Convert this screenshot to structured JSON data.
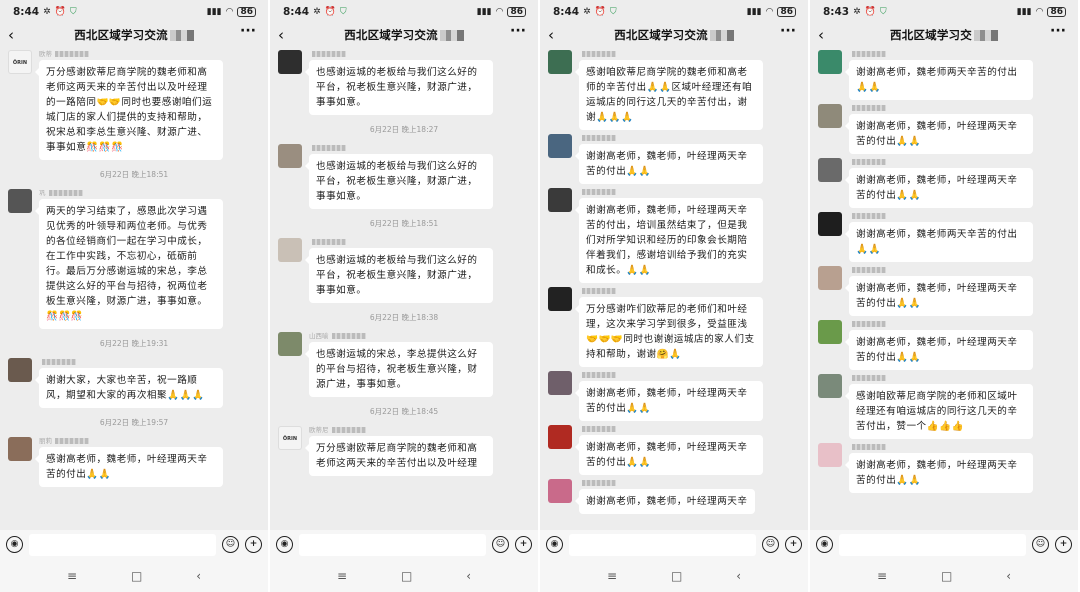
{
  "screens": [
    {
      "status": {
        "time": "8:44",
        "battery": "86"
      },
      "title": "西北区域学习交流",
      "messages": [
        {
          "type": "msg",
          "avatar": "#f4f4f4",
          "avatar_text": "ÖRIN",
          "name": "欧蒂",
          "text": "万分感谢欧蒂尼商学院的魏老师和高老师这两天来的辛苦付出以及叶经理的一路陪同🤝🤝同时也要感谢咱们运城门店的家人们提供的支持和帮助，祝宋总和李总生意兴隆、财源广进、事事如意🎊🎊🎊"
        },
        {
          "type": "time",
          "text": "6月22日 晚上18:51"
        },
        {
          "type": "msg",
          "avatar": "#555",
          "name": "巩",
          "text": "两天的学习结束了，感恩此次学习遇见优秀的叶领导和两位老师。与优秀的各位经销商们一起在学习中成长，在工作中实践，不忘初心，砥砺前行。最后万分感谢运城的宋总，李总提供这么好的平台与招待，祝两位老板生意兴隆，财源广进，事事如意。🎊🎊🎊"
        },
        {
          "type": "time",
          "text": "6月22日 晚上19:31"
        },
        {
          "type": "msg",
          "avatar": "#6a5a4e",
          "name": "",
          "text": "谢谢大家，大家也辛苦，祝一路顺风，期望和大家的再次相聚🙏🙏🙏"
        },
        {
          "type": "time",
          "text": "6月22日 晚上19:57"
        },
        {
          "type": "msg",
          "avatar": "#8a6d5a",
          "name": "丽莉",
          "text": "感谢高老师，魏老师，叶经理两天辛苦的付出🙏🙏"
        }
      ]
    },
    {
      "status": {
        "time": "8:44",
        "battery": "86"
      },
      "title": "西北区域学习交流",
      "messages": [
        {
          "type": "msg",
          "avatar": "#2e2e2e",
          "name": "",
          "text": "也感谢运城的老板给与我们这么好的平台，祝老板生意兴隆，财源广进，事事如意。"
        },
        {
          "type": "time",
          "text": "6月22日 晚上18:27"
        },
        {
          "type": "msg",
          "avatar": "#9a8e80",
          "name": "",
          "text": "也感谢运城的老板给与我们这么好的平台，祝老板生意兴隆，财源广进，事事如意。"
        },
        {
          "type": "time",
          "text": "6月22日 晚上18:51"
        },
        {
          "type": "msg",
          "avatar": "#c9c0b6",
          "name": "",
          "text": "也感谢运城的老板给与我们这么好的平台，祝老板生意兴隆，财源广进，事事如意。"
        },
        {
          "type": "time",
          "text": "6月22日 晚上18:38"
        },
        {
          "type": "msg",
          "avatar": "#7d8a6a",
          "name": "山西喻",
          "text": "也感谢运城的宋总，李总提供这么好的平台与招待，祝老板生意兴隆，财源广进，事事如意。"
        },
        {
          "type": "time",
          "text": "6月22日 晚上18:45"
        },
        {
          "type": "msg",
          "avatar": "#f4f4f4",
          "avatar_text": "ÖRIN",
          "name": "欧蒂尼",
          "text": "万分感谢欧蒂尼商学院的魏老师和高老师这两天来的辛苦付出以及叶经理"
        }
      ]
    },
    {
      "status": {
        "time": "8:44",
        "battery": "86"
      },
      "title": "西北区域学习交流",
      "messages": [
        {
          "type": "msg",
          "avatar": "#3d6e52",
          "name": "",
          "text": "感谢咱欧蒂尼商学院的魏老师和高老师的辛苦付出🙏🙏区域叶经理还有咱运城店的同行这几天的辛苦付出，谢谢🙏🙏🙏"
        },
        {
          "type": "msg",
          "avatar": "#4a6680",
          "name": "",
          "text": "谢谢高老师，魏老师，叶经理两天辛苦的付出🙏🙏"
        },
        {
          "type": "msg",
          "avatar": "#3a3a3a",
          "name": "",
          "text": "谢谢高老师，魏老师，叶经理两天辛苦的付出，培训虽然结束了，但是我们对所学知识和经历的印象会长期陪伴着我们，感谢培训给予我们的充实和成长。🙏🙏"
        },
        {
          "type": "msg",
          "avatar": "#222",
          "name": "",
          "text": "万分感谢咋们欧蒂尼的老师们和叶经理，这次来学习学到很多，受益匪浅🤝🤝🤝同时也谢谢运城店的家人们支持和帮助，谢谢🤗🙏"
        },
        {
          "type": "msg",
          "avatar": "#6f5f6a",
          "name": "",
          "text": "谢谢高老师，魏老师，叶经理两天辛苦的付出🙏🙏"
        },
        {
          "type": "msg",
          "avatar": "#b02a22",
          "name": "",
          "text": "谢谢高老师，魏老师，叶经理两天辛苦的付出🙏🙏"
        },
        {
          "type": "msg",
          "avatar": "#c96a8a",
          "name": "",
          "text": "谢谢高老师，魏老师，叶经理两天辛"
        }
      ]
    },
    {
      "status": {
        "time": "8:43",
        "battery": "86"
      },
      "title": "西北区域学习交",
      "messages": [
        {
          "type": "msg",
          "avatar": "#3a8a6a",
          "name": "",
          "text": "谢谢高老师，魏老师两天辛苦的付出🙏🙏"
        },
        {
          "type": "msg",
          "avatar": "#8f8a7a",
          "name": "",
          "text": "谢谢高老师，魏老师，叶经理两天辛苦的付出🙏🙏"
        },
        {
          "type": "msg",
          "avatar": "#6a6a6a",
          "name": "",
          "text": "谢谢高老师，魏老师，叶经理两天辛苦的付出🙏🙏"
        },
        {
          "type": "msg",
          "avatar": "#1e1e1e",
          "name": "",
          "text": "谢谢高老师，魏老师两天辛苦的付出🙏🙏"
        },
        {
          "type": "msg",
          "avatar": "#b8a090",
          "name": "",
          "text": "谢谢高老师，魏老师，叶经理两天辛苦的付出🙏🙏"
        },
        {
          "type": "msg",
          "avatar": "#6a9a4a",
          "name": "",
          "text": "谢谢高老师，魏老师，叶经理两天辛苦的付出🙏🙏"
        },
        {
          "type": "msg",
          "avatar": "#7a8a7a",
          "name": "",
          "text": "感谢咱欧蒂尼商学院的老师和区域叶经理还有咱运城店的同行这几天的辛苦付出，赞一个👍👍👍"
        },
        {
          "type": "msg",
          "avatar": "#e8c0c8",
          "name": "",
          "text": "谢谢高老师，魏老师，叶经理两天辛苦的付出🙏🙏"
        }
      ]
    }
  ],
  "icons": {
    "voice": "voice-icon",
    "emoji": "emoji-icon",
    "plus": "plus-icon",
    "back": "back-icon",
    "more": "more-icon"
  },
  "nav": {
    "menu": "≡",
    "home": "□",
    "back": "‹"
  }
}
